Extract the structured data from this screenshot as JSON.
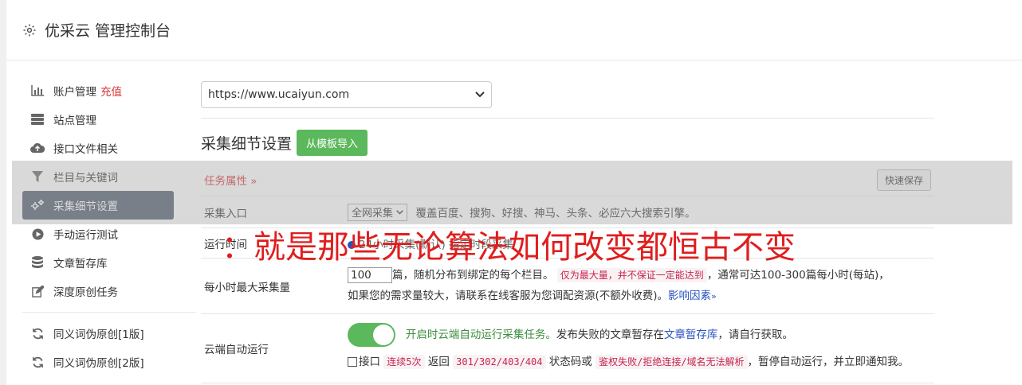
{
  "header": {
    "title": "优采云 管理控制台",
    "icon": "gear-icon"
  },
  "sidebar": {
    "items": [
      {
        "label": "账户管理",
        "extra": "充值",
        "icon": "bar-chart-icon"
      },
      {
        "label": "站点管理",
        "icon": "server-icon"
      },
      {
        "label": "接口文件相关",
        "icon": "cloud-upload-icon"
      },
      {
        "label": "栏目与关键词",
        "icon": "filter-icon"
      },
      {
        "label": "采集细节设置",
        "icon": "cogs-icon",
        "active": true
      },
      {
        "label": "手动运行测试",
        "icon": "play-circle-icon"
      },
      {
        "label": "文章暂存库",
        "icon": "database-icon"
      },
      {
        "label": "深度原创任务",
        "icon": "edit-icon"
      },
      {
        "label": "同义词伪原创[1版]",
        "icon": "refresh-icon"
      },
      {
        "label": "同义词伪原创[2版]",
        "icon": "refresh-icon"
      }
    ]
  },
  "main": {
    "site_select": "https://www.ucaiyun.com",
    "section_title": "采集细节设置",
    "import_button": "从模板导入",
    "task_attr": "任务属性",
    "quick_save": "快速保存",
    "rows": {
      "entry": {
        "label": "采集入口",
        "select": "全网采集",
        "desc": "覆盖百度、搜狗、好搜、神马、头条、必应六大搜索引擎。"
      },
      "time": {
        "label": "运行时间",
        "text": "24小时采集(默认) 指定时段采集"
      },
      "max": {
        "label": "每小时最大采集量",
        "value": "100",
        "text1": "篇，随机分布到绑定的每个栏目。",
        "tag1": "仅为最大量，并不保证一定能达到",
        "text2": "，通常可达100-300篇每小时(每站)，",
        "text3": "如果您的需求量较大，请联系在线客服为您调配资源(不额外收费)。",
        "link": "影响因素"
      },
      "cloud": {
        "label": "云端自动运行",
        "toggle_on": true,
        "green": "开启时云端自动运行采集任务。",
        "text1": "发布失败的文章暂存在",
        "link": "文章暂存库",
        "text2": "，请自行获取。",
        "cb_label": "接口",
        "tag1": "连续5次",
        "text3": "返回",
        "tag2": "301/302/403/404",
        "text4": "状态码或",
        "tag3": "鉴权失败/拒绝连接/域名无法解析",
        "text5": "，暂停自动运行，并立即通知我。"
      }
    }
  },
  "overlay": {
    "text": "：就是那些无论算法如何改变都恒古不变"
  }
}
